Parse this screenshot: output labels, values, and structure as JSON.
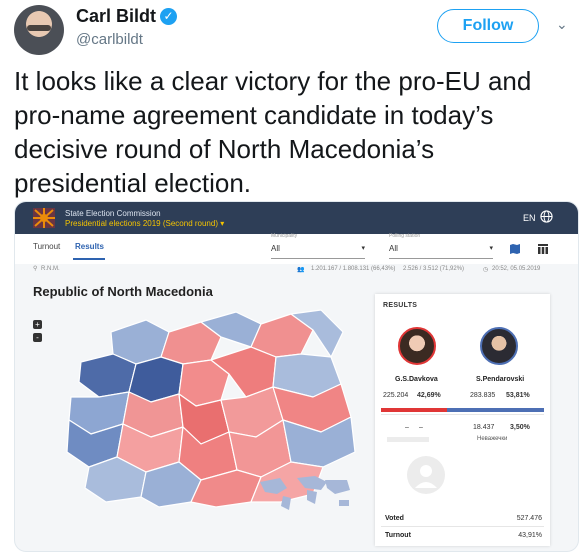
{
  "tweet": {
    "author_name": "Carl Bildt",
    "handle": "@carlbildt",
    "follow_label": "Follow",
    "text": "It looks like a clear victory for the pro-EU and pro-name agreement candidate in today’s decisive round of North Macedonia’s presidential election."
  },
  "embed": {
    "commission": "State Election Commission",
    "election": "Presidential elections 2019 (Second round) ▾",
    "language": "EN",
    "tabs": [
      "Turnout",
      "Results"
    ],
    "active_tab": "Results",
    "filters": [
      {
        "label": "Municipality",
        "value": "All"
      },
      {
        "label": "Polling station",
        "value": "All"
      }
    ],
    "location": "R.N.M.",
    "stats": {
      "voters": "1.201.167 / 1.808.131 (66,43%)",
      "stations": "2.526 / 3.512 (71,92%)",
      "time": "20:52, 05.05.2019"
    },
    "map_title": "Republic of North Macedonia",
    "zoom_in": "+",
    "zoom_out": "-",
    "results": {
      "title": "RESULTS",
      "candidates": [
        {
          "name": "G.S.Davkova",
          "votes": "225.204",
          "percent": "42,69%",
          "color": "#e03636"
        },
        {
          "name": "S.Pendarovski",
          "votes": "283.835",
          "percent": "53,81%",
          "color": "#4d6fb4"
        }
      ],
      "invalid": {
        "dash1": "–",
        "dash2": "–",
        "votes": "18.437",
        "percent": "3,50%",
        "label": "Неважечки"
      },
      "voted_label": "Voted",
      "voted_value": "527.476",
      "turnout_label": "Turnout",
      "turnout_value": "43,91%"
    }
  },
  "colors": {
    "accent": "#1da1f2",
    "header_bg": "#2e3e57",
    "red": "#e03636",
    "blue": "#4d6fb4"
  }
}
